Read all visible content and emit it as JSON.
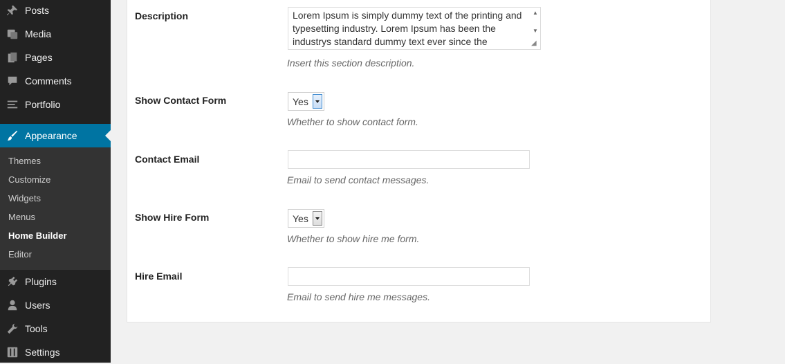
{
  "sidebar": {
    "top_items": [
      {
        "label": "Posts",
        "icon": "pin-icon"
      },
      {
        "label": "Media",
        "icon": "media-icon"
      },
      {
        "label": "Pages",
        "icon": "pages-icon"
      },
      {
        "label": "Comments",
        "icon": "comment-icon"
      },
      {
        "label": "Portfolio",
        "icon": "portfolio-icon"
      }
    ],
    "active": {
      "label": "Appearance",
      "icon": "brush-icon"
    },
    "submenu": [
      "Themes",
      "Customize",
      "Widgets",
      "Menus",
      "Home Builder",
      "Editor"
    ],
    "current_sub": "Home Builder",
    "bottom_items": [
      {
        "label": "Plugins",
        "icon": "plugin-icon"
      },
      {
        "label": "Users",
        "icon": "user-icon"
      },
      {
        "label": "Tools",
        "icon": "wrench-icon"
      },
      {
        "label": "Settings",
        "icon": "settings-icon"
      }
    ],
    "colors": {
      "bg": "#222222",
      "active": "#0074a2",
      "submenu_bg": "#333333"
    }
  },
  "form": {
    "description": {
      "label": "Description",
      "value": "Lorem Ipsum is simply dummy text of the printing and typesetting industry. Lorem Ipsum has been the industrys standard dummy text ever since the",
      "help": "Insert this section description."
    },
    "show_contact": {
      "label": "Show Contact Form",
      "value": "Yes",
      "help": "Whether to show contact form."
    },
    "contact_email": {
      "label": "Contact Email",
      "value": "",
      "help": "Email to send contact messages."
    },
    "show_hire": {
      "label": "Show Hire Form",
      "value": "Yes",
      "help": "Whether to show hire me form."
    },
    "hire_email": {
      "label": "Hire Email",
      "value": "",
      "help": "Email to send hire me messages."
    }
  }
}
